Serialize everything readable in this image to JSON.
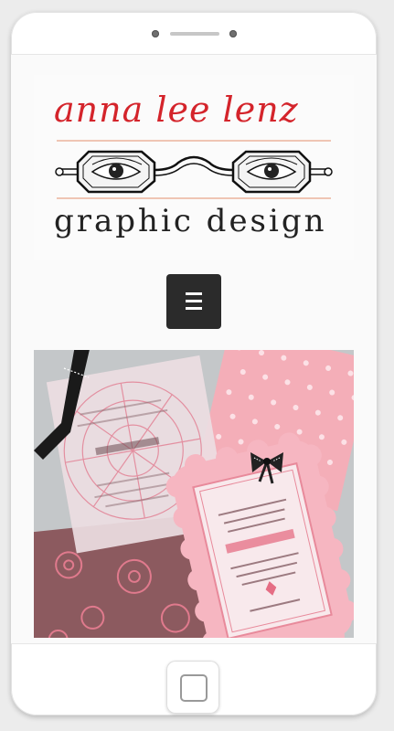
{
  "logo": {
    "title": "anna lee lenz",
    "subtitle": "graphic design",
    "title_color": "#d4242b",
    "rule_color": "#e8a58a"
  },
  "nav": {
    "menu_icon": "hamburger-menu-icon",
    "button_color": "#2b2b2b"
  },
  "colors": {
    "pink": "#f4aeb8",
    "card_pink": "#f6b6c1",
    "brown": "#8c5a5f",
    "photo_background": "#c4c7c9"
  },
  "device": {
    "home_icon": "home-button-icon"
  }
}
